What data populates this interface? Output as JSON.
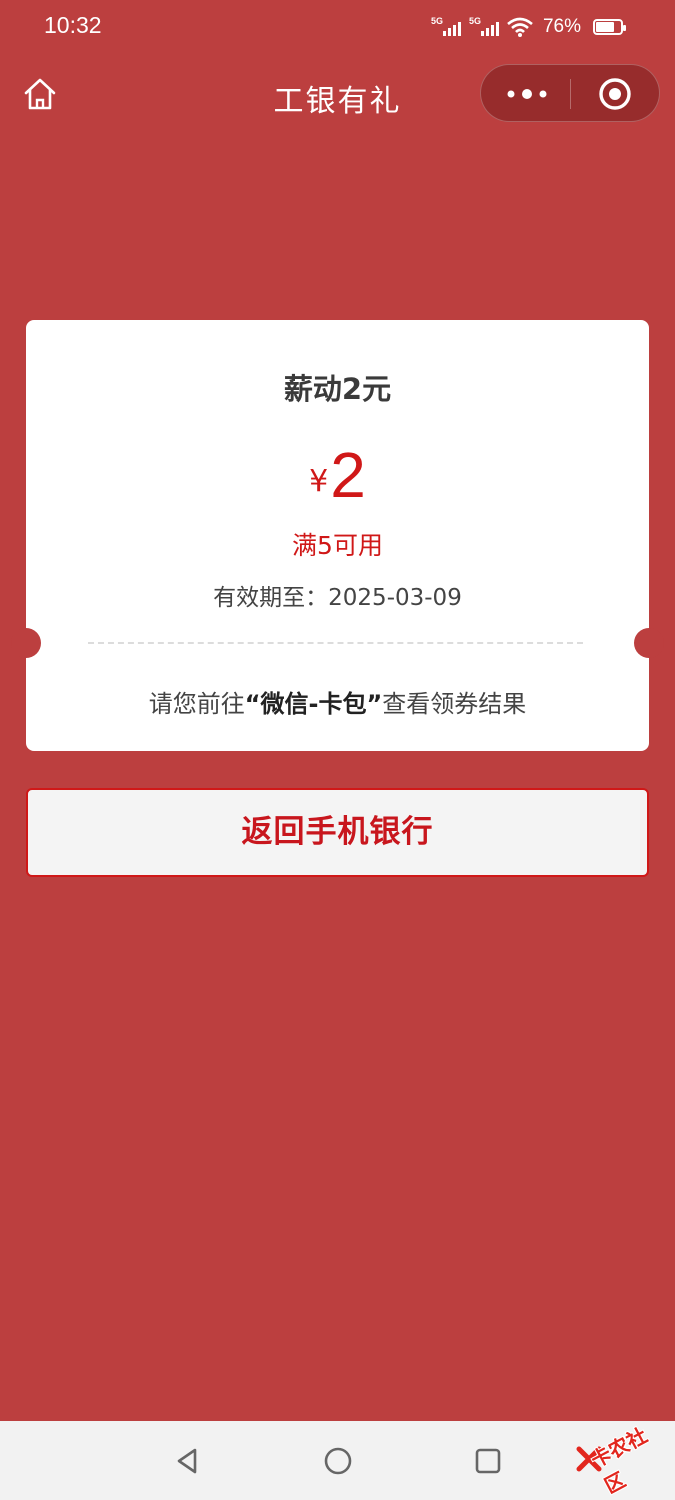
{
  "status_bar": {
    "time": "10:32",
    "network_1": "5G",
    "network_2": "5G",
    "battery_percent": "76%",
    "battery_level": 0.76
  },
  "nav": {
    "title": "工银有礼",
    "home_icon": "home-icon",
    "more_icon": "more-dots-icon",
    "close_icon": "target-circle-icon"
  },
  "coupon": {
    "name": "薪动2元",
    "currency": "¥",
    "amount": "2",
    "condition": "满5可用",
    "validity_label": "有效期至：",
    "validity_date": "2025-03-09",
    "hint_prefix": "请您前往",
    "hint_highlight": "“微信-卡包”",
    "hint_suffix": "查看领券结果"
  },
  "button": {
    "label": "返回手机银行"
  },
  "system_nav": {
    "back_icon": "triangle-back-icon",
    "home_icon": "circle-home-icon",
    "recent_icon": "square-recents-icon"
  },
  "watermark": {
    "text": "卡农社区"
  },
  "colors": {
    "background": "#bc3f3f",
    "accent_red": "#d01818",
    "card": "#ffffff"
  }
}
